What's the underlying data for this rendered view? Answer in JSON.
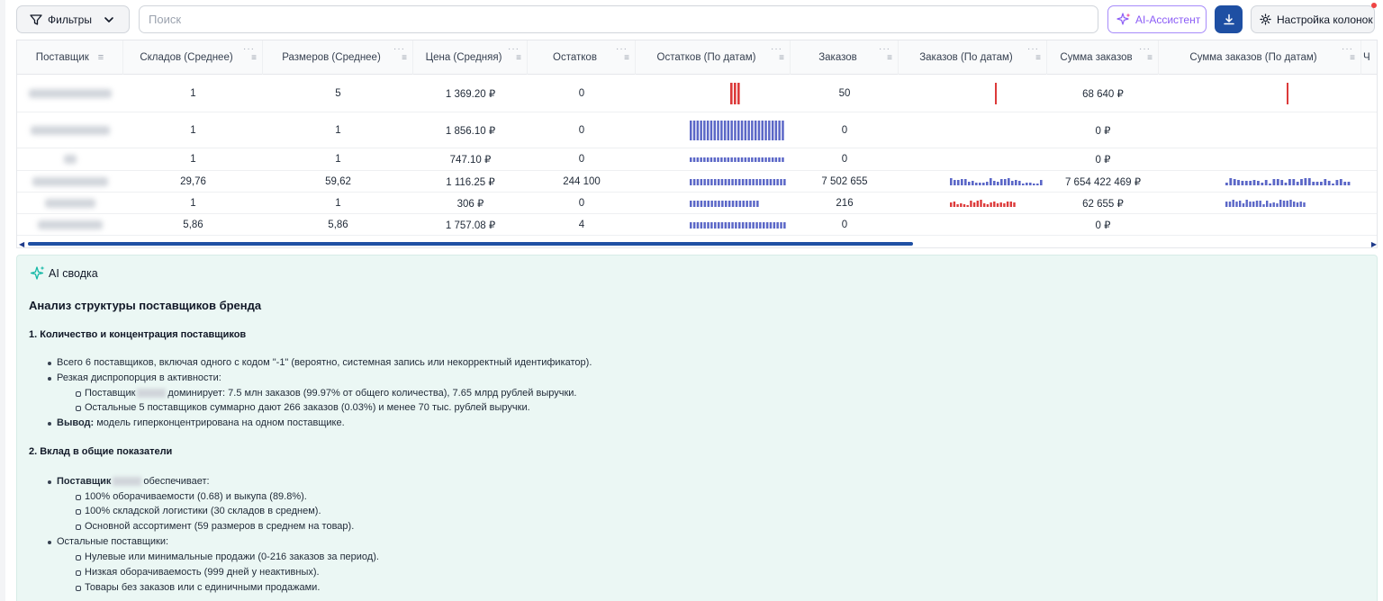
{
  "toolbar": {
    "filters_label": "Фильтры",
    "search_placeholder": "Поиск",
    "ai_label": "AI-Ассистент",
    "columns_label": "Настройка колонок"
  },
  "table": {
    "columns": [
      "Поставщик",
      "Складов (Среднее)",
      "Размеров (Среднее)",
      "Цена (Средняя)",
      "Остатков",
      "Остатков (По датам)",
      "Заказов",
      "Заказов (По датам)",
      "Сумма заказов",
      "Сумма заказов (По датам)",
      "Ч"
    ],
    "rows": [
      {
        "warehouses": "1",
        "sizes": "5",
        "price": "1 369.20 ₽",
        "stock": "0",
        "orders": "50",
        "order_sum": "68 640 ₽"
      },
      {
        "warehouses": "1",
        "sizes": "1",
        "price": "1 856.10 ₽",
        "stock": "0",
        "orders": "0",
        "order_sum": "0 ₽"
      },
      {
        "warehouses": "1",
        "sizes": "1",
        "price": "747.10 ₽",
        "stock": "0",
        "orders": "0",
        "order_sum": "0 ₽"
      },
      {
        "warehouses": "29,76",
        "sizes": "59,62",
        "price": "1 116.25 ₽",
        "stock": "244 100",
        "orders": "7 502 655",
        "order_sum": "7 654 422 469 ₽"
      },
      {
        "warehouses": "1",
        "sizes": "1",
        "price": "306 ₽",
        "stock": "0",
        "orders": "216",
        "order_sum": "62 655 ₽"
      },
      {
        "warehouses": "5,86",
        "sizes": "5,86",
        "price": "1 757.08 ₽",
        "stock": "4",
        "orders": "0",
        "order_sum": "0 ₽"
      }
    ]
  },
  "summary": {
    "title": "AI сводка",
    "heading": "Анализ структуры поставщиков бренда",
    "section1_title": "1. Количество и концентрация поставщиков",
    "s1_item1": "Всего 6 поставщиков, включая одного с кодом \"-1\" (вероятно, системная запись или некорректный идентификатор).",
    "s1_item2": "Резкая диспропорция в активности:",
    "s1_sub1_pre": "Поставщик",
    "s1_sub1_post": "доминирует: 7.5 млн заказов (99.97% от общего количества), 7.65 млрд рублей выручки.",
    "s1_sub2": "Остальные 5 поставщиков суммарно дают 266 заказов (0.03%) и менее 70 тыс. рублей выручки.",
    "s1_item3_bold": "Вывод:",
    "s1_item3": " модель гиперконцентрирована на одном поставщике.",
    "section2_title": "2. Вклад в общие показатели",
    "s2_item1_bold": "Поставщик",
    "s2_item1_post": "обеспечивает:",
    "s2_sub1": "100% оборачиваемости (0.68) и выкупа (89.8%).",
    "s2_sub2": "100% складской логистики (30 складов в среднем).",
    "s2_sub3": "Основной ассортимент (59 размеров в среднем на товар).",
    "s2_item2": "Остальные поставщики:",
    "s2_sub4": "Нулевые или минимальные продажи (0-216 заказов за период).",
    "s2_sub5": "Низкая оборачиваемость (999 дней у неактивных).",
    "s2_sub6": "Товары без заказов или с единичными продажами."
  },
  "colors": {
    "accent": "#1e4fa3",
    "spark_blue": "#5b67c7",
    "spark_red": "#dc3a3a",
    "summary_bg": "#ebf7f4",
    "ai_purple": "#8b5cf6"
  }
}
